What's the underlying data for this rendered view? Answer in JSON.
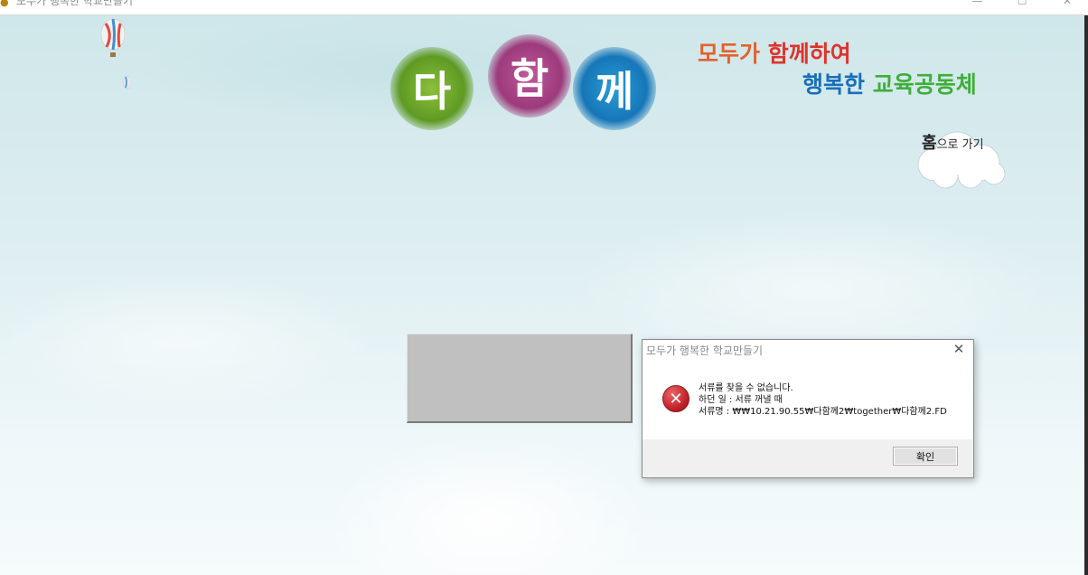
{
  "window": {
    "title": "모두가 행복한 학교만들기",
    "minimize": "—",
    "maximize": "☐",
    "close": "✕",
    "app_icon": "app-icon"
  },
  "header": {
    "logo_chars": [
      "다",
      "함",
      "께"
    ],
    "slogan_line1_a": "모두가 ",
    "slogan_line1_b": "함께하여",
    "slogan_line2_a": "행복한 ",
    "slogan_line2_b": "교육공동체",
    "home_main": "홈",
    "home_rest": "으로 가기"
  },
  "dialog": {
    "title": "모두가 행복한 학교만들기",
    "close": "✕",
    "icon": "error-icon",
    "icon_glyph": "✕",
    "message": [
      "서류를 찾을 수 없습니다.",
      "하던 일 : 서류 꺼낼 때",
      "서류명 : ₩₩10.21.90.55₩다함께2₩together₩다함께2.FD"
    ],
    "ok": "확인"
  },
  "colors": {
    "green": "#5e9a23",
    "magenta": "#9c3a7b",
    "blue": "#1676b8",
    "orange": "#e6612b",
    "red": "#e0322b",
    "slogan_blue": "#1a6fb8",
    "slogan_green": "#3fae3a"
  }
}
